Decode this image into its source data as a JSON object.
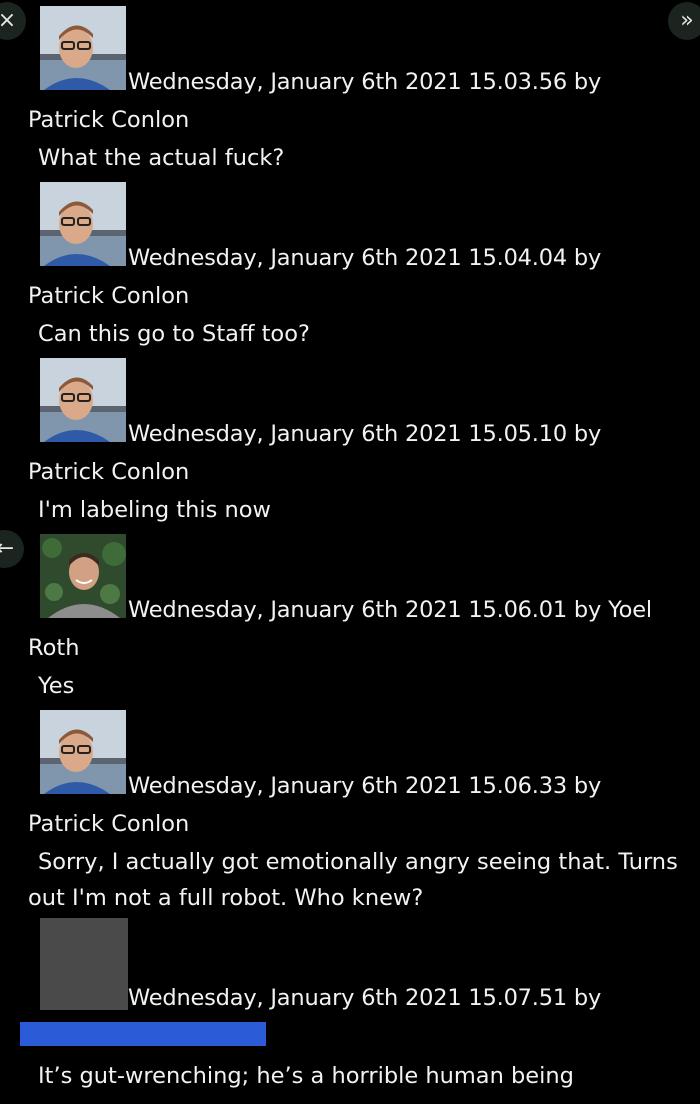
{
  "controls": {
    "close_glyph": "×",
    "forward_glyph": "»",
    "back_glyph": "←"
  },
  "messages": [
    {
      "timestamp": "Wednesday, January 6th 2021 15.03.56 by",
      "author": "Patrick Conlon",
      "text": "What the actual fuck?"
    },
    {
      "timestamp": "Wednesday, January 6th 2021 15.04.04 by",
      "author": "Patrick Conlon",
      "text": "Can this go to Staff too?"
    },
    {
      "timestamp": "Wednesday, January 6th 2021 15.05.10 by",
      "author": "Patrick Conlon",
      "text": "I'm labeling this now"
    },
    {
      "timestamp": "Wednesday, January 6th 2021 15.06.01 by Yoel",
      "author": "Roth",
      "text": "Yes"
    },
    {
      "timestamp": "Wednesday, January 6th 2021 15.06.33 by",
      "author": "Patrick Conlon",
      "text_line1": "Sorry, I actually got emotionally angry seeing that. Turns",
      "text_line2": "out I'm not a full robot. Who knew?"
    },
    {
      "timestamp": "Wednesday, January 6th 2021 15.07.51 by",
      "author_redacted": true,
      "text": "It’s gut-wrenching; he’s a horrible human being"
    }
  ],
  "colors": {
    "background": "#000000",
    "text": "#f2f2f2",
    "redaction_bar": "#2b5bd7",
    "redacted_avatar": "#4a4a4a"
  }
}
